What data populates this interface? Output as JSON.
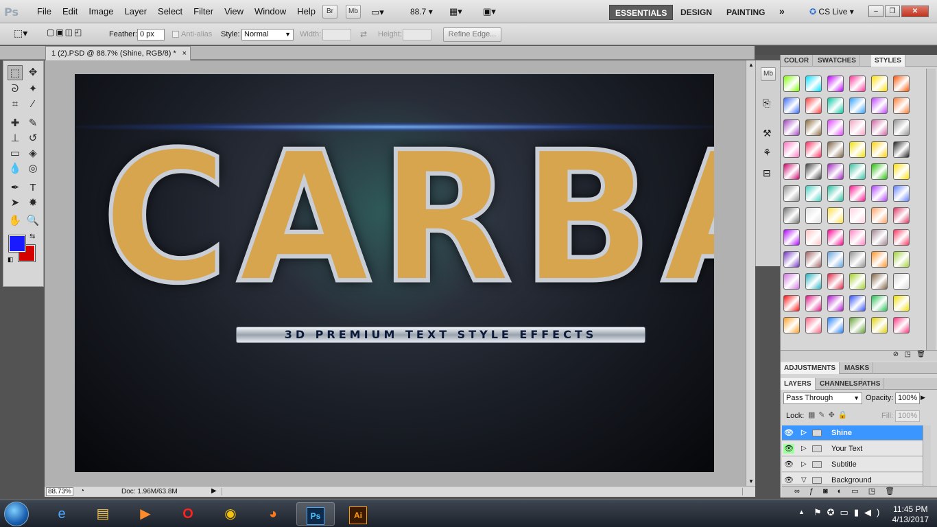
{
  "app": {
    "name": "Ps"
  },
  "menu": [
    "File",
    "Edit",
    "Image",
    "Layer",
    "Select",
    "Filter",
    "View",
    "Window",
    "Help"
  ],
  "appbar": {
    "zoom": "88.7",
    "br": "Br",
    "mb": "Mb"
  },
  "workspaces": [
    "ESSENTIALS",
    "DESIGN",
    "PAINTING"
  ],
  "cs_live": "CS Live",
  "options": {
    "feather_label": "Feather:",
    "feather_value": "0 px",
    "antialias_label": "Anti-alias",
    "style_label": "Style:",
    "style_value": "Normal",
    "width_label": "Width:",
    "height_label": "Height:",
    "refine_edge": "Refine Edge..."
  },
  "document": {
    "tab_title": "1 (2).PSD @ 88.7% (Shine, RGB/8) *",
    "close": "×"
  },
  "artwork": {
    "main_text": "CARBA",
    "subtitle": "3D PREMIUM TEXT STYLE EFFECTS"
  },
  "status": {
    "zoom": "88.73%",
    "doc": "Doc: 1.96M/63.8M"
  },
  "panels": {
    "top_tabs": [
      "COLOR",
      "SWATCHES",
      "STYLES"
    ],
    "adj_tabs": [
      "ADJUSTMENTS",
      "MASKS"
    ],
    "layer_tabs": [
      "LAYERS",
      "CHANNELS",
      "PATHS"
    ]
  },
  "layers_panel": {
    "blend_mode": "Pass Through",
    "opacity_label": "Opacity:",
    "opacity_value": "100%",
    "lock_label": "Lock:",
    "fill_label": "Fill:",
    "fill_value": "100%",
    "layers": [
      "Shine",
      "Your Text",
      "Subtitle",
      "Background"
    ]
  },
  "colors": {
    "foreground": "#1a1aff",
    "background": "#d40000",
    "selected_layer": "#3c96ff"
  },
  "style_swatches": [
    "#7fff00",
    "#00e0ff",
    "#c000ff",
    "#ff3399",
    "#ffe000",
    "#ff5500",
    "#3a6bff",
    "#ff3b3b",
    "#00c8a0",
    "#2aa0ff",
    "#c040ff",
    "#ff7a30",
    "#a040c0",
    "#8a6a3a",
    "#e040ff",
    "#f2a0c0",
    "#d060a0",
    "#909090",
    "#ff70c0",
    "#ff2a60",
    "#7a6040",
    "#f0e000",
    "#ffd000",
    "#202020",
    "#d0006a",
    "#404040",
    "#a020c0",
    "#30c0a0",
    "#20c000",
    "#ffe000",
    "#909090",
    "#40d0c0",
    "#20c0a0",
    "#ff1090",
    "#b040ff",
    "#6080ff",
    "#707070",
    "#e0e0e0",
    "#ffe040",
    "#ffd0e0",
    "#ffa060",
    "#e03060",
    "#b000ff",
    "#ffc0c0",
    "#ff0090",
    "#ff80c0",
    "#a08090",
    "#ff3060",
    "#7030c0",
    "#a06060",
    "#60a0e0",
    "#909090",
    "#ff9020",
    "#a0d030",
    "#d070e0",
    "#20b0c0",
    "#e02040",
    "#a0d020",
    "#806040",
    "#d8d8d8",
    "#ff1010",
    "#e01080",
    "#b010d0",
    "#3050ff",
    "#20c050",
    "#f0e000",
    "#ffa020",
    "#ff6080",
    "#2080ff",
    "#60a030",
    "#e0d000",
    "#ff3080"
  ],
  "taskbar": {
    "time": "11:45 PM",
    "date": "4/13/2017"
  }
}
